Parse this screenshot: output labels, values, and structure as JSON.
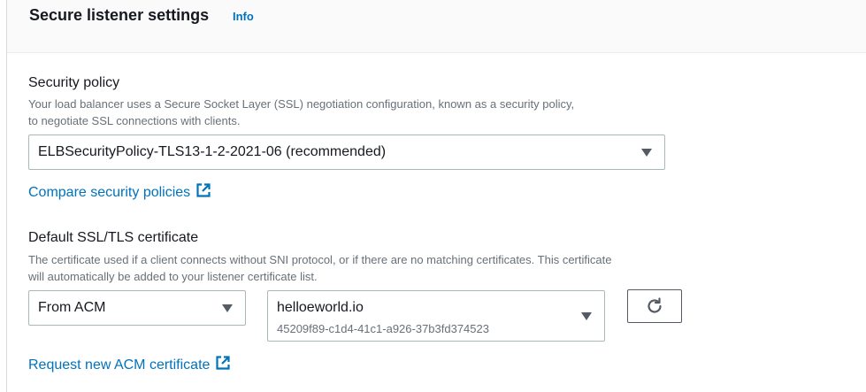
{
  "header": {
    "title": "Secure listener settings",
    "info_label": "Info"
  },
  "security_policy": {
    "label": "Security policy",
    "description_line1": "Your load balancer uses a Secure Socket Layer (SSL) negotiation configuration, known as a security policy,",
    "description_line2": "to negotiate SSL connections with clients.",
    "selected_value": "ELBSecurityPolicy-TLS13-1-2-2021-06 (recommended)",
    "compare_link": "Compare security policies"
  },
  "certificate": {
    "label": "Default SSL/TLS certificate",
    "description_line1": "The certificate used if a client connects without SNI protocol, or if there are no matching certificates. This certificate",
    "description_line2": "will automatically be added to your listener certificate list.",
    "source_value": "From ACM",
    "cert_name": "helloeworld.io",
    "cert_id": "45209f89-c1d4-41c1-a926-37b3fd374523",
    "request_link": "Request new ACM certificate"
  },
  "icons": {
    "external_link": "external-link-icon",
    "refresh": "refresh-icon",
    "dropdown": "caret-down-icon"
  },
  "colors": {
    "link": "#0073bb",
    "text": "#16191f",
    "secondary_text": "#687078",
    "border": "#aab7b8"
  }
}
